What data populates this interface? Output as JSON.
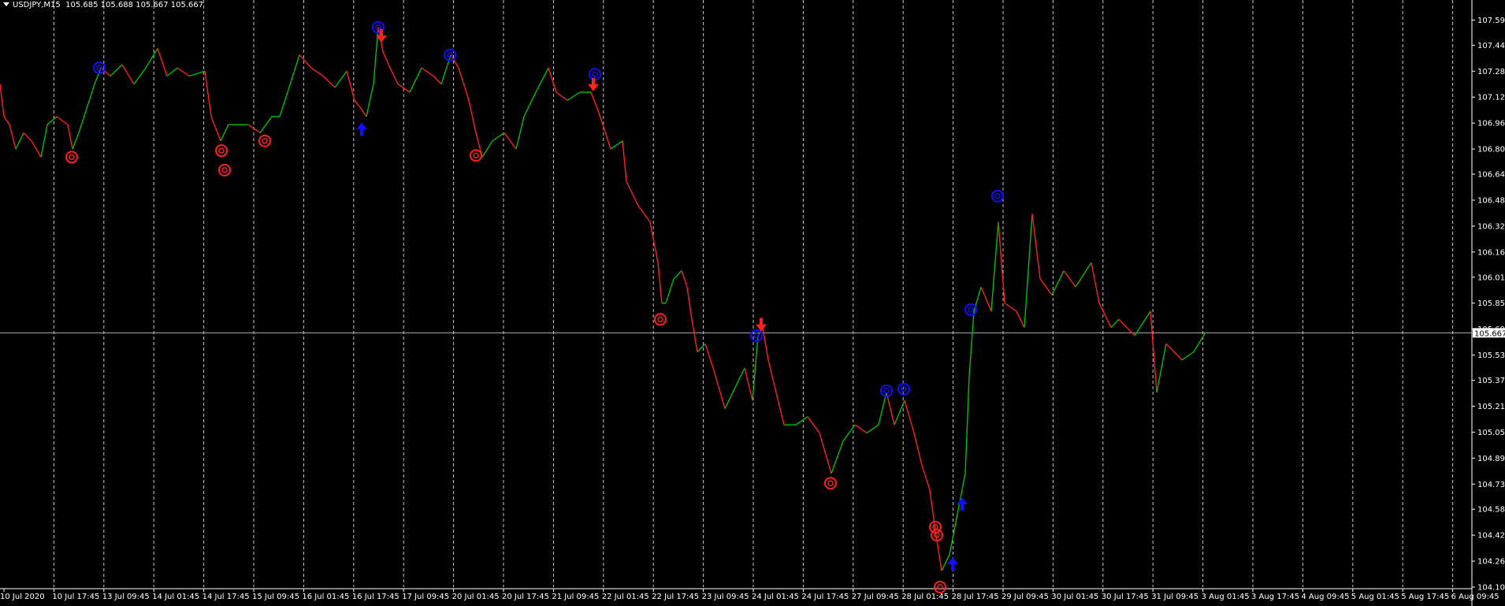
{
  "header": {
    "symbol": "USDJPY,M15",
    "ohlc": "105.685 105.688 105.667 105.667"
  },
  "colors": {
    "background": "#000000",
    "up": "#00c000",
    "down": "#ff2020",
    "grid": "#c8c8c8",
    "text": "#ffffff",
    "buy": "#1010ff",
    "sell": "#ff2020",
    "bid_line": "#b0b0b0"
  },
  "chart_data": {
    "type": "line",
    "title": "USDJPY,M15",
    "ylim": [
      104.1,
      107.67
    ],
    "y_ticks": [
      "107.595",
      "107.440",
      "107.280",
      "107.120",
      "106.960",
      "106.800",
      "106.645",
      "106.485",
      "106.325",
      "106.165",
      "106.010",
      "105.850",
      "105.690",
      "105.530",
      "105.375",
      "105.215",
      "105.055",
      "104.895",
      "104.735",
      "104.580",
      "104.420",
      "104.260",
      "104.100"
    ],
    "x_ticks": [
      "10 Jul 2020",
      "10 Jul 17:45",
      "13 Jul 09:45",
      "14 Jul 01:45",
      "14 Jul 17:45",
      "15 Jul 09:45",
      "16 Jul 01:45",
      "16 Jul 17:45",
      "17 Jul 09:45",
      "20 Jul 01:45",
      "20 Jul 17:45",
      "21 Jul 09:45",
      "22 Jul 01:45",
      "22 Jul 17:45",
      "23 Jul 09:45",
      "24 Jul 01:45",
      "24 Jul 17:45",
      "27 Jul 09:45",
      "28 Jul 01:45",
      "28 Jul 17:45",
      "29 Jul 09:45",
      "30 Jul 01:45",
      "30 Jul 17:45",
      "31 Jul 09:45",
      "3 Aug 01:45",
      "3 Aug 17:45",
      "4 Aug 09:45",
      "5 Aug 01:45",
      "5 Aug 17:45",
      "6 Aug 09:45"
    ],
    "current_price": "105.667",
    "price_path": [
      [
        0,
        107.2
      ],
      [
        5,
        107.0
      ],
      [
        12,
        106.95
      ],
      [
        20,
        106.8
      ],
      [
        30,
        106.9
      ],
      [
        40,
        106.85
      ],
      [
        52,
        106.75
      ],
      [
        60,
        106.95
      ],
      [
        72,
        107.0
      ],
      [
        86,
        106.95
      ],
      [
        92,
        106.8
      ],
      [
        100,
        106.9
      ],
      [
        110,
        107.05
      ],
      [
        120,
        107.2
      ],
      [
        128,
        107.3
      ],
      [
        140,
        107.25
      ],
      [
        155,
        107.32
      ],
      [
        170,
        107.2
      ],
      [
        185,
        107.3
      ],
      [
        200,
        107.42
      ],
      [
        212,
        107.25
      ],
      [
        225,
        107.3
      ],
      [
        240,
        107.25
      ],
      [
        260,
        107.28
      ],
      [
        268,
        107.0
      ],
      [
        280,
        106.85
      ],
      [
        290,
        106.95
      ],
      [
        300,
        106.95
      ],
      [
        315,
        106.95
      ],
      [
        330,
        106.9
      ],
      [
        345,
        107.0
      ],
      [
        355,
        107.0
      ],
      [
        365,
        107.15
      ],
      [
        380,
        107.38
      ],
      [
        395,
        107.3
      ],
      [
        410,
        107.25
      ],
      [
        425,
        107.18
      ],
      [
        440,
        107.28
      ],
      [
        450,
        107.1
      ],
      [
        458,
        107.05
      ],
      [
        465,
        107.0
      ],
      [
        474,
        107.2
      ],
      [
        480,
        107.55
      ],
      [
        486,
        107.4
      ],
      [
        495,
        107.3
      ],
      [
        505,
        107.2
      ],
      [
        520,
        107.15
      ],
      [
        535,
        107.3
      ],
      [
        550,
        107.25
      ],
      [
        560,
        107.2
      ],
      [
        572,
        107.38
      ],
      [
        582,
        107.3
      ],
      [
        595,
        107.1
      ],
      [
        604,
        106.9
      ],
      [
        612,
        106.75
      ],
      [
        625,
        106.85
      ],
      [
        640,
        106.9
      ],
      [
        655,
        106.8
      ],
      [
        665,
        107.0
      ],
      [
        680,
        107.15
      ],
      [
        696,
        107.3
      ],
      [
        706,
        107.15
      ],
      [
        720,
        107.1
      ],
      [
        736,
        107.15
      ],
      [
        750,
        107.15
      ],
      [
        758,
        107.05
      ],
      [
        765,
        106.95
      ],
      [
        775,
        106.8
      ],
      [
        790,
        106.85
      ],
      [
        795,
        106.6
      ],
      [
        810,
        106.45
      ],
      [
        825,
        106.35
      ],
      [
        835,
        106.1
      ],
      [
        840,
        105.85
      ],
      [
        845,
        105.85
      ],
      [
        855,
        106.0
      ],
      [
        865,
        106.05
      ],
      [
        872,
        105.95
      ],
      [
        878,
        105.75
      ],
      [
        885,
        105.55
      ],
      [
        895,
        105.6
      ],
      [
        905,
        105.45
      ],
      [
        920,
        105.2
      ],
      [
        935,
        105.35
      ],
      [
        945,
        105.45
      ],
      [
        955,
        105.25
      ],
      [
        962,
        105.65
      ],
      [
        968,
        105.7
      ],
      [
        975,
        105.5
      ],
      [
        985,
        105.3
      ],
      [
        995,
        105.1
      ],
      [
        1010,
        105.1
      ],
      [
        1025,
        105.15
      ],
      [
        1040,
        105.05
      ],
      [
        1055,
        104.8
      ],
      [
        1070,
        105.0
      ],
      [
        1085,
        105.1
      ],
      [
        1100,
        105.05
      ],
      [
        1115,
        105.1
      ],
      [
        1125,
        105.3
      ],
      [
        1135,
        105.1
      ],
      [
        1148,
        105.25
      ],
      [
        1160,
        105.05
      ],
      [
        1170,
        104.85
      ],
      [
        1180,
        104.7
      ],
      [
        1187,
        104.45
      ],
      [
        1195,
        104.2
      ],
      [
        1205,
        104.3
      ],
      [
        1215,
        104.55
      ],
      [
        1225,
        104.8
      ],
      [
        1230,
        105.4
      ],
      [
        1236,
        105.8
      ],
      [
        1245,
        105.95
      ],
      [
        1258,
        105.8
      ],
      [
        1267,
        106.35
      ],
      [
        1275,
        105.85
      ],
      [
        1290,
        105.8
      ],
      [
        1300,
        105.7
      ],
      [
        1310,
        106.4
      ],
      [
        1320,
        106.0
      ],
      [
        1335,
        105.9
      ],
      [
        1350,
        106.05
      ],
      [
        1365,
        105.95
      ],
      [
        1385,
        106.1
      ],
      [
        1395,
        105.85
      ],
      [
        1410,
        105.7
      ],
      [
        1420,
        105.75
      ],
      [
        1440,
        105.65
      ],
      [
        1460,
        105.8
      ],
      [
        1468,
        105.3
      ],
      [
        1480,
        105.6
      ],
      [
        1500,
        105.5
      ],
      [
        1515,
        105.55
      ],
      [
        1530,
        105.67
      ]
    ],
    "signals": [
      {
        "kind": "target-sell",
        "x": 91,
        "price": 106.75
      },
      {
        "kind": "target-buy",
        "x": 126,
        "price": 107.3
      },
      {
        "kind": "target-sell",
        "x": 281,
        "price": 106.79
      },
      {
        "kind": "target-sell",
        "x": 285,
        "price": 106.67
      },
      {
        "kind": "target-sell",
        "x": 336,
        "price": 106.85
      },
      {
        "kind": "arrow-up",
        "x": 459,
        "price": 106.92
      },
      {
        "kind": "target-buy",
        "x": 480,
        "price": 107.55
      },
      {
        "kind": "arrow-down",
        "x": 484,
        "price": 107.5
      },
      {
        "kind": "target-buy",
        "x": 571,
        "price": 107.38
      },
      {
        "kind": "target-sell",
        "x": 604,
        "price": 106.76
      },
      {
        "kind": "target-buy",
        "x": 755,
        "price": 107.26
      },
      {
        "kind": "arrow-down",
        "x": 753,
        "price": 107.2
      },
      {
        "kind": "target-sell",
        "x": 838,
        "price": 105.75
      },
      {
        "kind": "target-buy",
        "x": 960,
        "price": 105.65
      },
      {
        "kind": "arrow-down",
        "x": 966,
        "price": 105.72
      },
      {
        "kind": "target-sell",
        "x": 1054,
        "price": 104.74
      },
      {
        "kind": "target-buy",
        "x": 1125,
        "price": 105.31
      },
      {
        "kind": "target-buy",
        "x": 1147,
        "price": 105.32
      },
      {
        "kind": "target-sell",
        "x": 1187,
        "price": 104.47
      },
      {
        "kind": "target-sell",
        "x": 1189,
        "price": 104.42
      },
      {
        "kind": "target-sell",
        "x": 1193,
        "price": 104.1
      },
      {
        "kind": "arrow-up",
        "x": 1209,
        "price": 104.24
      },
      {
        "kind": "arrow-up",
        "x": 1221,
        "price": 104.61
      },
      {
        "kind": "target-buy",
        "x": 1232,
        "price": 105.81
      },
      {
        "kind": "target-buy",
        "x": 1266,
        "price": 106.51
      }
    ]
  }
}
